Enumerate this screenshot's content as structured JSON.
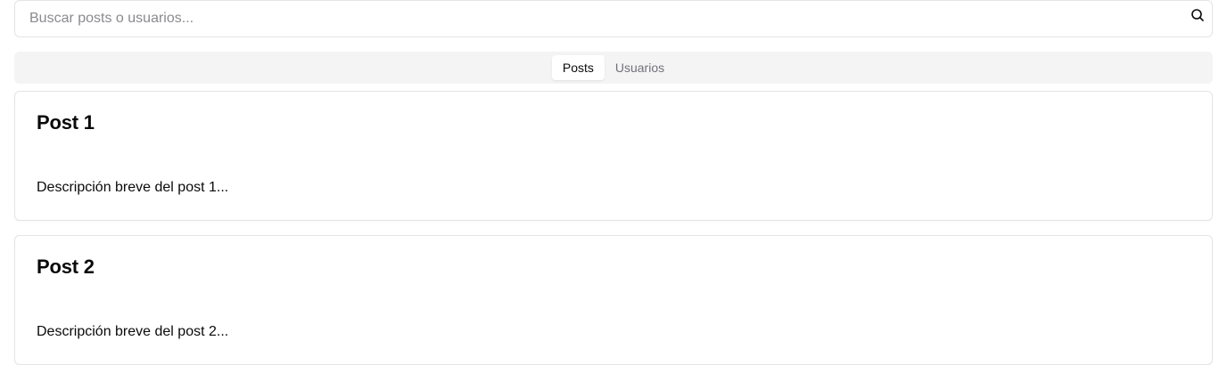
{
  "search": {
    "placeholder": "Buscar posts o usuarios...",
    "value": "",
    "icon": "search-icon"
  },
  "tabs": [
    {
      "label": "Posts",
      "active": true
    },
    {
      "label": "Usuarios",
      "active": false
    }
  ],
  "posts": [
    {
      "title": "Post 1",
      "description": "Descripción breve del post 1..."
    },
    {
      "title": "Post 2",
      "description": "Descripción breve del post 2..."
    }
  ],
  "colors": {
    "border": "#e4e4e7",
    "tabs_background": "#f4f4f5",
    "active_tab_background": "#ffffff",
    "text": "#0a0a0a",
    "muted_text": "#71717a",
    "placeholder_text": "#8a8a8f"
  }
}
